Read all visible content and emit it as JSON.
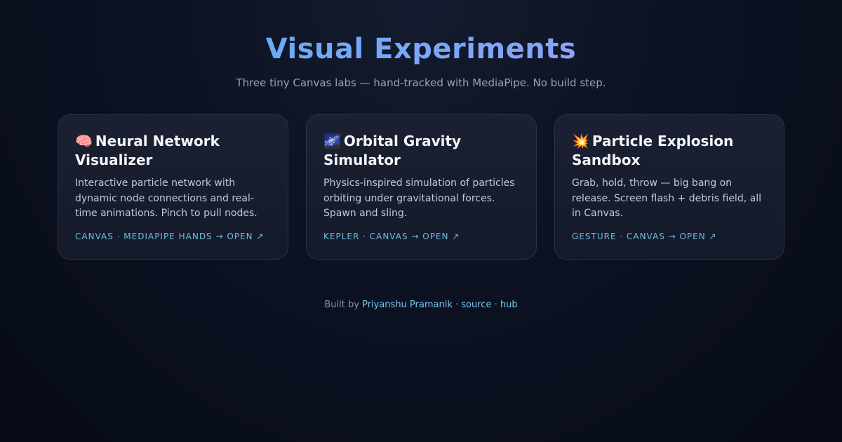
{
  "header": {
    "title": "Visual Experiments",
    "subtitle": "Three tiny Canvas labs — hand-tracked with MediaPipe. No build step."
  },
  "cards": [
    {
      "emoji": "🧠",
      "emoji_icon": "brain-icon",
      "title": "Neural Network Visualizer",
      "description": "Interactive particle network with dynamic node connections and real-time animations. Pinch to pull nodes.",
      "tags": "CANVAS · MEDIAPIPE HANDS → OPEN ↗"
    },
    {
      "emoji": "🌌",
      "emoji_icon": "galaxy-icon",
      "title": "Orbital Gravity Simulator",
      "description": "Physics-inspired simulation of particles orbiting under gravitational forces. Spawn and sling.",
      "tags": "KEPLER · CANVAS → OPEN ↗"
    },
    {
      "emoji": "💥",
      "emoji_icon": "explosion-icon",
      "title": "Particle Explosion Sandbox",
      "description": "Grab, hold, throw — big bang on release. Screen flash + debris field, all in Canvas.",
      "tags": "GESTURE · CANVAS → OPEN ↗"
    }
  ],
  "footer": {
    "prefix": "Built by",
    "author": "Priyanshu Pramanik",
    "separator": "·",
    "source_link": "source",
    "hub_link": "hub"
  },
  "colors": {
    "background": "#0c1222",
    "title_gradient_start": "#4fb2f5",
    "title_gradient_end": "#a99cf6",
    "tag_color": "#6cbde8",
    "link_color": "#7cc7f3"
  }
}
